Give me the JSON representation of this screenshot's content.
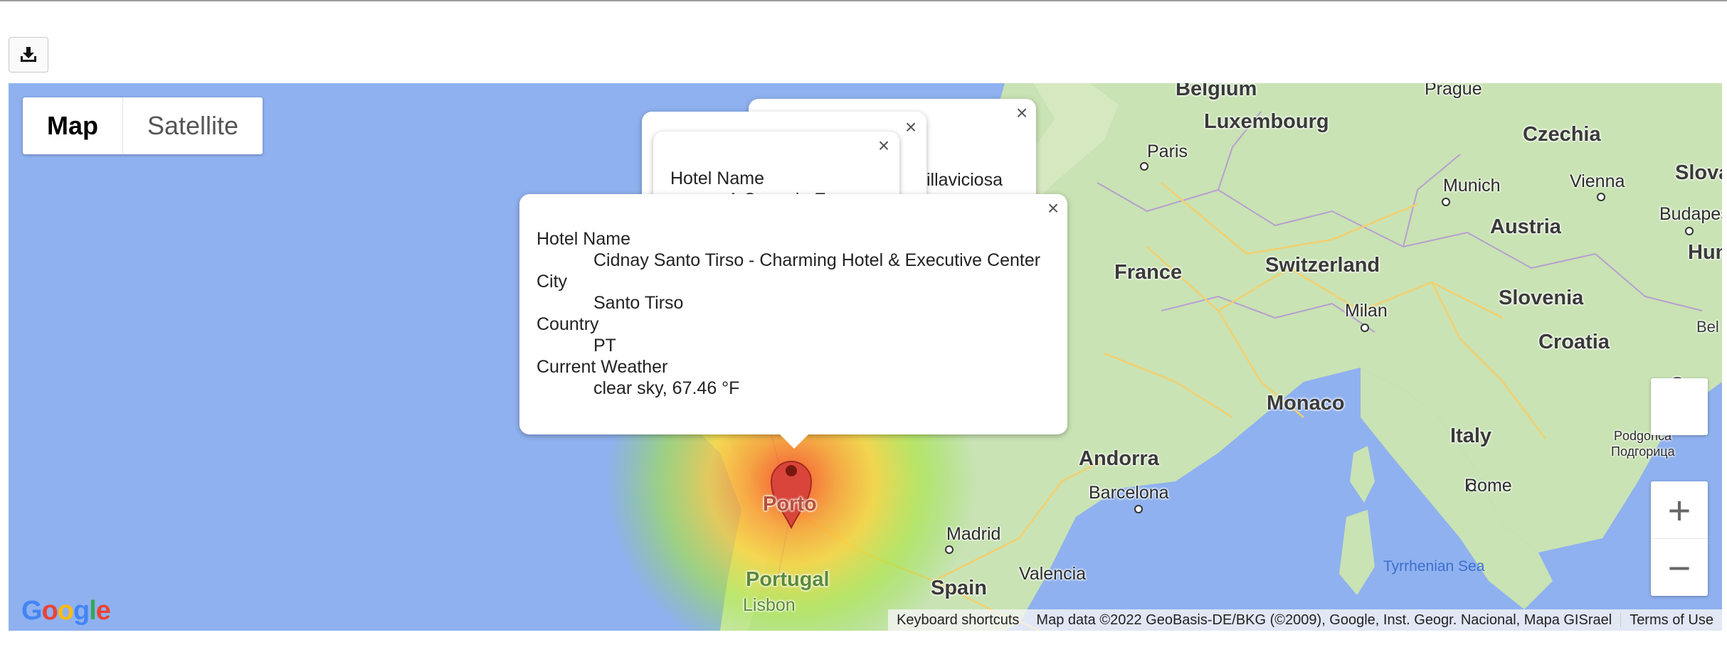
{
  "toolbar": {
    "download_icon": "download-icon"
  },
  "map": {
    "type_control": {
      "map_label": "Map",
      "satellite_label": "Satellite",
      "selected": "Map"
    },
    "countries": {
      "belgium": "Belgium",
      "luxembourg": "Luxembourg",
      "czechia": "Czechia",
      "slovakia": "Slovak",
      "austria": "Austria",
      "hungary": "Hunga",
      "france": "France",
      "switzerland": "Switzerland",
      "slovenia": "Slovenia",
      "croatia": "Croatia",
      "monaco": "Monaco",
      "italy": "Italy",
      "andorra": "Andorra",
      "spain": "Spain",
      "portugal": "Portugal",
      "bel": "Bel",
      "sar": "Sar"
    },
    "cities": {
      "prague": "Prague",
      "paris": "Paris",
      "munich": "Munich",
      "vienna": "Vienna",
      "budapest": "Budapest",
      "milan": "Milan",
      "barcelona": "Barcelona",
      "madrid": "Madrid",
      "valencia": "Valencia",
      "rome": "Rome",
      "porto": "Porto",
      "lisbon": "Lisbon",
      "podgorica": "Podgorica",
      "podgorica_cyr": "Подгорица",
      "villaviciosa_partial": "illaviciosa"
    },
    "sea": {
      "tyrrhenian": "Tyrrhenian Sea"
    },
    "heatmap_colors": [
      "#ff3b1f",
      "#ffd12e",
      "#7ee03a"
    ],
    "marker_color": "#d9453a",
    "info_window_back": {
      "name_label": "Hotel Name",
      "name_partial": "A Casa do Eos"
    },
    "info_window": {
      "fields": [
        {
          "label": "Hotel Name",
          "value": "Cidnay Santo Tirso - Charming Hotel & Executive Center"
        },
        {
          "label": "City",
          "value": "Santo Tirso"
        },
        {
          "label": "Country",
          "value": "PT"
        },
        {
          "label": "Current Weather",
          "value": "clear sky, 67.46 °F"
        }
      ]
    },
    "zoom": {
      "in": "+",
      "out": "−"
    },
    "attribution": {
      "shortcuts": "Keyboard shortcuts",
      "data": "Map data ©2022 GeoBasis-DE/BKG (©2009), Google, Inst. Geogr. Nacional, Mapa GISrael",
      "terms": "Terms of Use"
    },
    "logo": "Google"
  }
}
